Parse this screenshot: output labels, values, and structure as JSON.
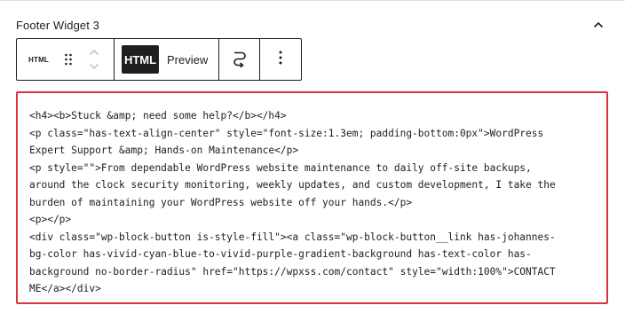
{
  "panel": {
    "title": "Footer Widget 3"
  },
  "toolbar": {
    "block_type_label": "HTML",
    "mode_html_label": "HTML",
    "mode_preview_label": "Preview"
  },
  "editor": {
    "lines": [
      "<h4><b>Stuck &amp; need some help?</b></h4>",
      "<p class=\"has-text-align-center\" style=\"font-size:1.3em; padding-bottom:0px\">WordPress",
      "Expert Support &amp; Hands-on Maintenance</p>",
      "<p style=\"\">From dependable WordPress website maintenance to daily off-site backups,",
      "around the clock security monitoring, weekly updates, and custom development, I take the",
      "burden of maintaining your WordPress website off your hands.</p>",
      "<p></p>",
      "<div class=\"wp-block-button is-style-fill\"><a class=\"wp-block-button__link has-johannes-",
      "bg-color has-vivid-cyan-blue-to-vivid-purple-gradient-background has-text-color has-",
      "background no-border-radius\" href=\"https://wpxss.com/contact\" style=\"width:100%\">CONTACT",
      "ME</a></div>"
    ]
  },
  "colors": {
    "error_border": "#d63638",
    "text": "#1e1e1e",
    "active_segment_bg": "#1e1e1e"
  }
}
